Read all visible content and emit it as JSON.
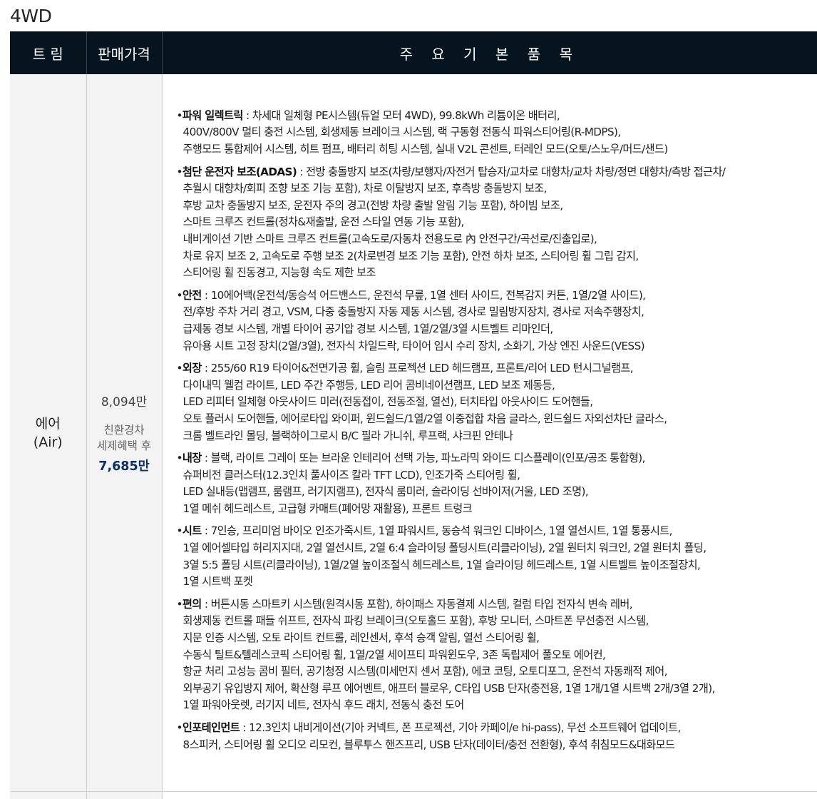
{
  "heading": "4WD",
  "table": {
    "headers": {
      "trim": "트 림",
      "price": "판매가격",
      "items": "주 요 기 본 품 목"
    },
    "row": {
      "trim_line1": "에어",
      "trim_line2": "(Air)",
      "price_base": "8,094만",
      "price_label_1": "친환경차",
      "price_label_2": "세제혜택 후",
      "price_after": "7,685만"
    },
    "features": [
      {
        "name": "파워 일렉트릭",
        "lines": [
          " : 차세대 일체형 PE시스템(듀얼 모터 4WD), 99.8kWh 리튬이온 배터리,",
          "400V/800V 멀티 충전 시스템, 회생제동 브레이크 시스템, 랙 구동형 전동식 파워스티어링(R-MDPS),",
          "주행모드 통합제어 시스템, 히트 펌프, 배터리 히팅 시스템, 실내 V2L 콘센트, 터레인 모드(오토/스노우/머드/샌드)"
        ]
      },
      {
        "name": "첨단 운전자 보조(ADAS)",
        "lines": [
          " : 전방 충돌방지 보조(차량/보행자/자전거 탑승자/교차로 대향차/교차 차량/정면 대향차/측방 접근차/",
          "추월시 대향차/회피 조향 보조 기능 포함), 차로 이탈방지 보조, 후측방 충돌방지 보조,",
          "후방 교차 충돌방지 보조, 운전자 주의 경고(전방 차량 출발 알림 기능 포함), 하이빔 보조,",
          "스마트 크루즈 컨트롤(정차&재출발, 운전 스타일 연동 기능 포함),",
          "내비게이션 기반 스마트 크루즈 컨트롤(고속도로/자동차 전용도로 內 안전구간/곡선로/진출입로),",
          "차로 유지 보조 2, 고속도로 주행 보조 2(차로변경 보조 기능 포함), 안전 하차 보조, 스티어링 휠 그립 감지,",
          "스티어링 휠 진동경고, 지능형 속도 제한 보조"
        ]
      },
      {
        "name": "안전",
        "lines": [
          " : 10에어백(운전석/동승석 어드밴스드, 운전석 무릎, 1열 센터 사이드, 전복감지 커튼, 1열/2열 사이드),",
          "전/후방 주차 거리 경고, VSM, 다중 충돌방지 자동 제동 시스템, 경사로 밀림방지장치, 경사로 저속주행장치,",
          "급제동 경보 시스템, 개별 타이어 공기압 경보 시스템, 1열/2열/3열 시트벨트 리마인더,",
          "유아용 시트 고정 장치(2열/3열), 전자식 차일드락, 타이어 임시 수리 장치, 소화기, 가상 엔진 사운드(VESS)"
        ]
      },
      {
        "name": "외장",
        "lines": [
          " : 255/60 R19 타이어&전면가공 휠, 슬림 프로젝션 LED 헤드램프, 프론트/리어 LED 턴시그널램프,",
          "다이내믹 웰컴 라이트, LED 주간 주행등, LED 리어 콤비네이션램프, LED 보조 제동등,",
          "LED 리피터 일체형 아웃사이드 미러(전동접이, 전동조절, 열선), 터치타입 아웃사이드 도어핸들,",
          "오토 플러시 도어핸들, 에어로타입 와이퍼, 윈드쉴드/1열/2열 이중접합 차음 글라스, 윈드쉴드 자외선차단 글라스,",
          "크롬 벨트라인 몰딩, 블랙하이그로시 B/C 필라 가니쉬, 루프랙, 샤크핀 안테나"
        ]
      },
      {
        "name": "내장",
        "lines": [
          " : 블랙, 라이트 그레이 또는 브라운 인테리어 선택 가능, 파노라믹 와이드 디스플레이(인포/공조 통합형),",
          "슈퍼비전 클러스터(12.3인치 풀사이즈 칼라 TFT LCD), 인조가죽 스티어링 휠,",
          "LED 실내등(맵램프, 룸램프, 러기지램프), 전자식 룸미러, 슬라이딩 선바이저(거울, LED 조명),",
          "1열 메쉬 헤드레스트, 고급형 카매트(폐어망 재활용), 프론트 트렁크"
        ]
      },
      {
        "name": "시트",
        "lines": [
          " : 7인승, 프리미엄 바이오 인조가죽시트, 1열 파워시트, 동승석 워크인 디바이스, 1열 열선시트, 1열 통풍시트,",
          "1열 에어셀타입 허리지지대, 2열 열선시트, 2열 6:4 슬라이딩 폴딩시트(리클라이닝), 2열 원터치 워크인, 2열 원터치 폴딩,",
          "3열 5:5 폴딩 시트(리클라이닝), 1열/2열 높이조절식 헤드레스트, 1열 슬라이딩 헤드레스트, 1열 시트벨트 높이조절장치,",
          "1열 시트백 포켓"
        ]
      },
      {
        "name": "편의",
        "lines": [
          " : 버튼시동 스마트키 시스템(원격시동 포함), 하이패스 자동결제 시스템, 컬럼 타입 전자식 변속 레버,",
          "회생제동 컨트롤 패들 쉬프트, 전자식 파킹 브레이크(오토홀드 포함), 후방 모니터, 스마트폰 무선충전 시스템,",
          "지문 인증 시스템, 오토 라이트 컨트롤, 레인센서, 후석 승객 알림, 열선 스티어링 휠,",
          "수동식 틸트&텔레스코픽 스티어링 휠, 1열/2열 세이프티 파워윈도우, 3존 독립제어 풀오토 에어컨,",
          "항균 처리 고성능 콤비 필터, 공기청정 시스템(미세먼지 센서 포함), 에코 코팅, 오토디포그, 운전석 자동쾌적 제어,",
          "외부공기 유입방지 제어, 확산형 루프 에어벤트, 애프터 블로우, C타입 USB 단자(충전용, 1열 1개/1열 시트백 2개/3열 2개),",
          "1열 파워아웃렛, 러기지 네트, 전자식 후드 래치, 전동식 충전 도어"
        ]
      },
      {
        "name": "인포테인먼트",
        "lines": [
          " : 12.3인치 내비게이션(기아 커넥트, 폰 프로젝션, 기아 카페이/e hi-pass), 무선 소프트웨어 업데이트,",
          "8스피커, 스티어링 휠 오디오 리모컨, 블루투스 핸즈프리, USB 단자(데이터/충전 전환형), 후석 취침모드&대화모드"
        ]
      }
    ]
  }
}
